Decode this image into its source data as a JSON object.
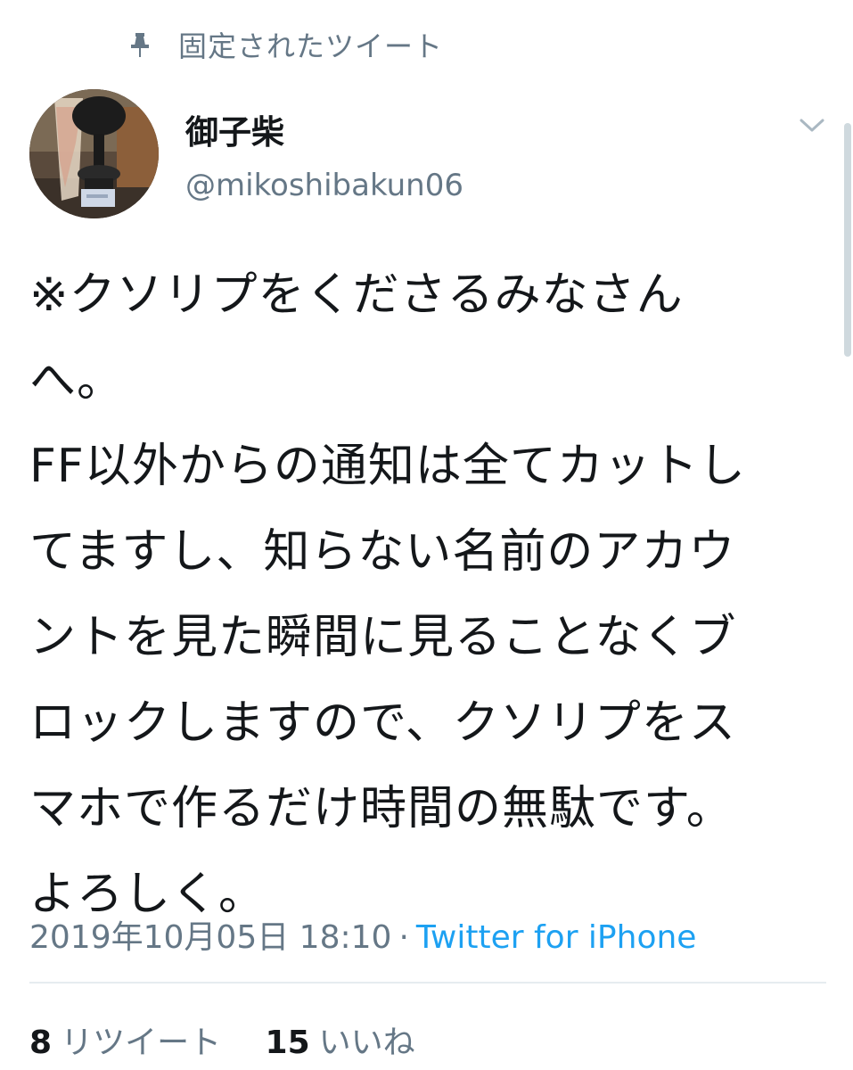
{
  "pinned": {
    "label": "固定されたツイート",
    "icon": "pin-icon"
  },
  "author": {
    "name": "御子柴",
    "handle": "@mikoshibakun06",
    "avatar_icon": "trophy-photo-avatar"
  },
  "tweet": {
    "text": "※クソリプをくださるみなさん\nへ。\nFF以外からの通知は全てカットし\nてますし、知らない名前のアカウ\nントを見た瞬間に見ることなくブ\nロックしますので、クソリプをス\nマホで作るだけ時間の無駄です。\nよろしく。",
    "timestamp": "2019年10月05日 18:10",
    "separator": "·",
    "source": "Twitter for iPhone"
  },
  "stats": {
    "retweets_count": "8",
    "retweets_label": "リツイート",
    "likes_count": "15",
    "likes_label": "いいね"
  },
  "colors": {
    "text": "#14171a",
    "secondary": "#657786",
    "link": "#1da1f2",
    "divider": "#e6ecf0"
  }
}
